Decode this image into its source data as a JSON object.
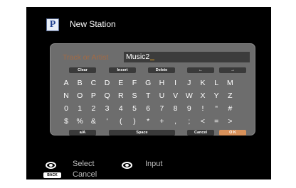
{
  "header": {
    "icon_letter": "P",
    "title": "New Station"
  },
  "input": {
    "label": "Track or Artist",
    "value": "Music2"
  },
  "function_keys": [
    {
      "label": "Clear"
    },
    {
      "label": "Insert"
    },
    {
      "label": "Delete"
    },
    {
      "label": "←"
    },
    {
      "label": "→"
    }
  ],
  "char_rows": [
    [
      "A",
      "B",
      "C",
      "D",
      "E",
      "F",
      "G",
      "H",
      "I",
      "J",
      "K",
      "L",
      "M"
    ],
    [
      "N",
      "O",
      "P",
      "Q",
      "R",
      "S",
      "T",
      "U",
      "V",
      "W",
      "X",
      "Y",
      "Z"
    ],
    [
      "0",
      "1",
      "2",
      "3",
      "4",
      "5",
      "6",
      "7",
      "8",
      "9",
      "!",
      "“",
      "#"
    ],
    [
      "$",
      "%",
      "&",
      "'",
      "(",
      ")",
      "*",
      "+",
      ",",
      ";",
      "<",
      "=",
      ">"
    ]
  ],
  "bottom_keys": [
    {
      "label": "a/A"
    },
    {
      "label": "Space"
    },
    {
      "label": "Cancel"
    },
    {
      "label": "O K",
      "selected": true
    }
  ],
  "hints": {
    "select": "Select",
    "input": "Input",
    "back_button": "BACK",
    "cancel": "Cancel"
  },
  "colors": {
    "panel": "#6d6d6d",
    "input_label": "#a46a43",
    "selected_key": "#d8915a",
    "screen_bg": "#000000"
  }
}
